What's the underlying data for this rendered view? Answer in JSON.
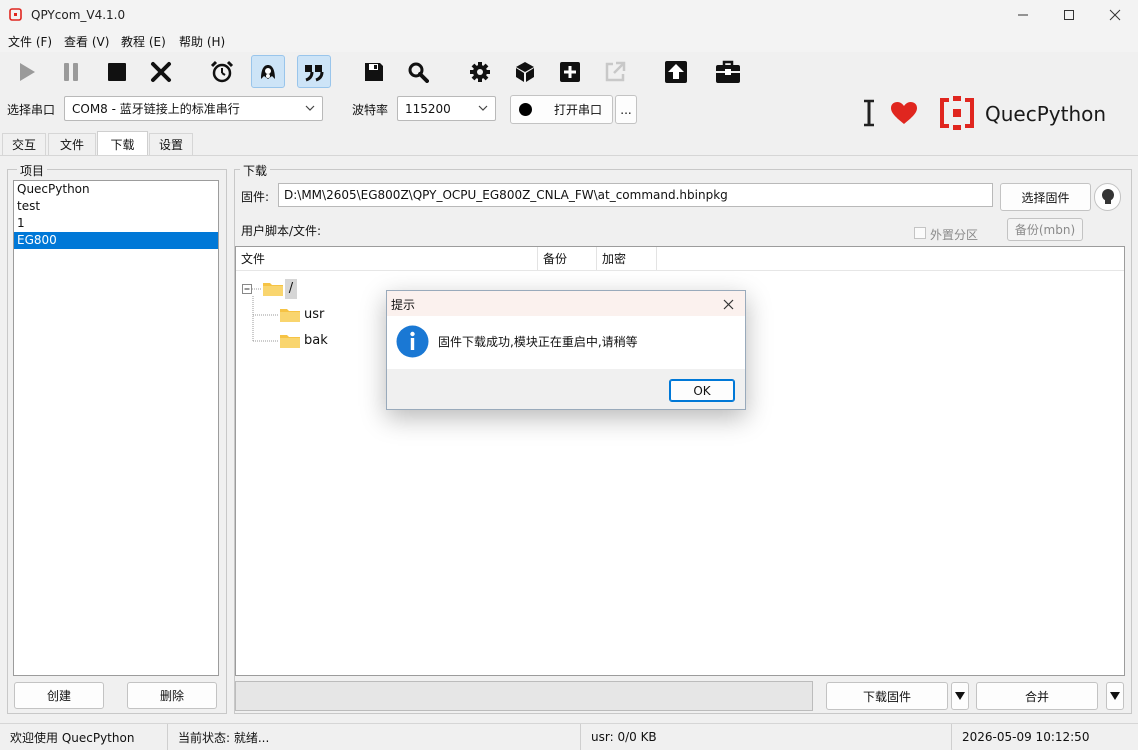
{
  "window": {
    "title": "QPYcom_V4.1.0",
    "minimize_icon": "minimize-icon",
    "maximize_icon": "maximize-icon",
    "close_icon": "close-icon"
  },
  "menu": [
    "文件 (F)",
    "查看 (V)",
    "教程 (E)",
    "帮助 (H)"
  ],
  "toolbar": [
    "play-icon",
    "pause-icon",
    "stop-icon",
    "clear-icon",
    "alarm-clock-icon",
    "bug-icon",
    "quote-icon",
    "save-icon",
    "search-icon",
    "gear-icon",
    "cube-icon",
    "add-icon",
    "external-link-icon",
    "upload-icon",
    "toolbox-icon"
  ],
  "serial": {
    "port_label": "选择串口",
    "port_value": "COM8 - 蓝牙链接上的标准串行",
    "baud_label": "波特率",
    "baud_value": "115200",
    "open_button": "打开串口",
    "more_button": "..."
  },
  "brand": {
    "name": "QuecPython",
    "colors": {
      "accent": "#e0261f",
      "selection": "#0078d7"
    }
  },
  "tabs": [
    "交互",
    "文件",
    "下载",
    "设置"
  ],
  "selected_tab": "下载",
  "projects": {
    "title": "项目",
    "items": [
      "QuecPython",
      "test",
      "1",
      "EG800"
    ],
    "selected": "EG800",
    "create_button": "创建",
    "delete_button": "删除"
  },
  "download": {
    "title": "下载",
    "firmware_label": "固件:",
    "firmware_path": "D:\\MM\\2605\\EG800Z\\QPY_OCPU_EG800Z_CNLA_FW\\at_command.hbinpkg",
    "select_firmware_button": "选择固件",
    "user_scripts_label": "用户脚本/文件:",
    "external_partition_label": "外置分区",
    "backup_button": "备份(mbn)",
    "columns": [
      "文件",
      "备份",
      "加密"
    ],
    "tree": {
      "root": "/",
      "children": [
        "usr",
        "bak"
      ]
    },
    "download_firmware_button": "下载固件",
    "merge_button": "合并"
  },
  "dialog": {
    "title": "提示",
    "message": "固件下载成功,模块正在重启中,请稍等",
    "ok_button": "OK"
  },
  "status": {
    "welcome": "欢迎使用 QuecPython",
    "state": "当前状态: 就绪...",
    "usr": "usr: 0/0 KB",
    "datetime": "2026-05-09 10:12:50"
  }
}
